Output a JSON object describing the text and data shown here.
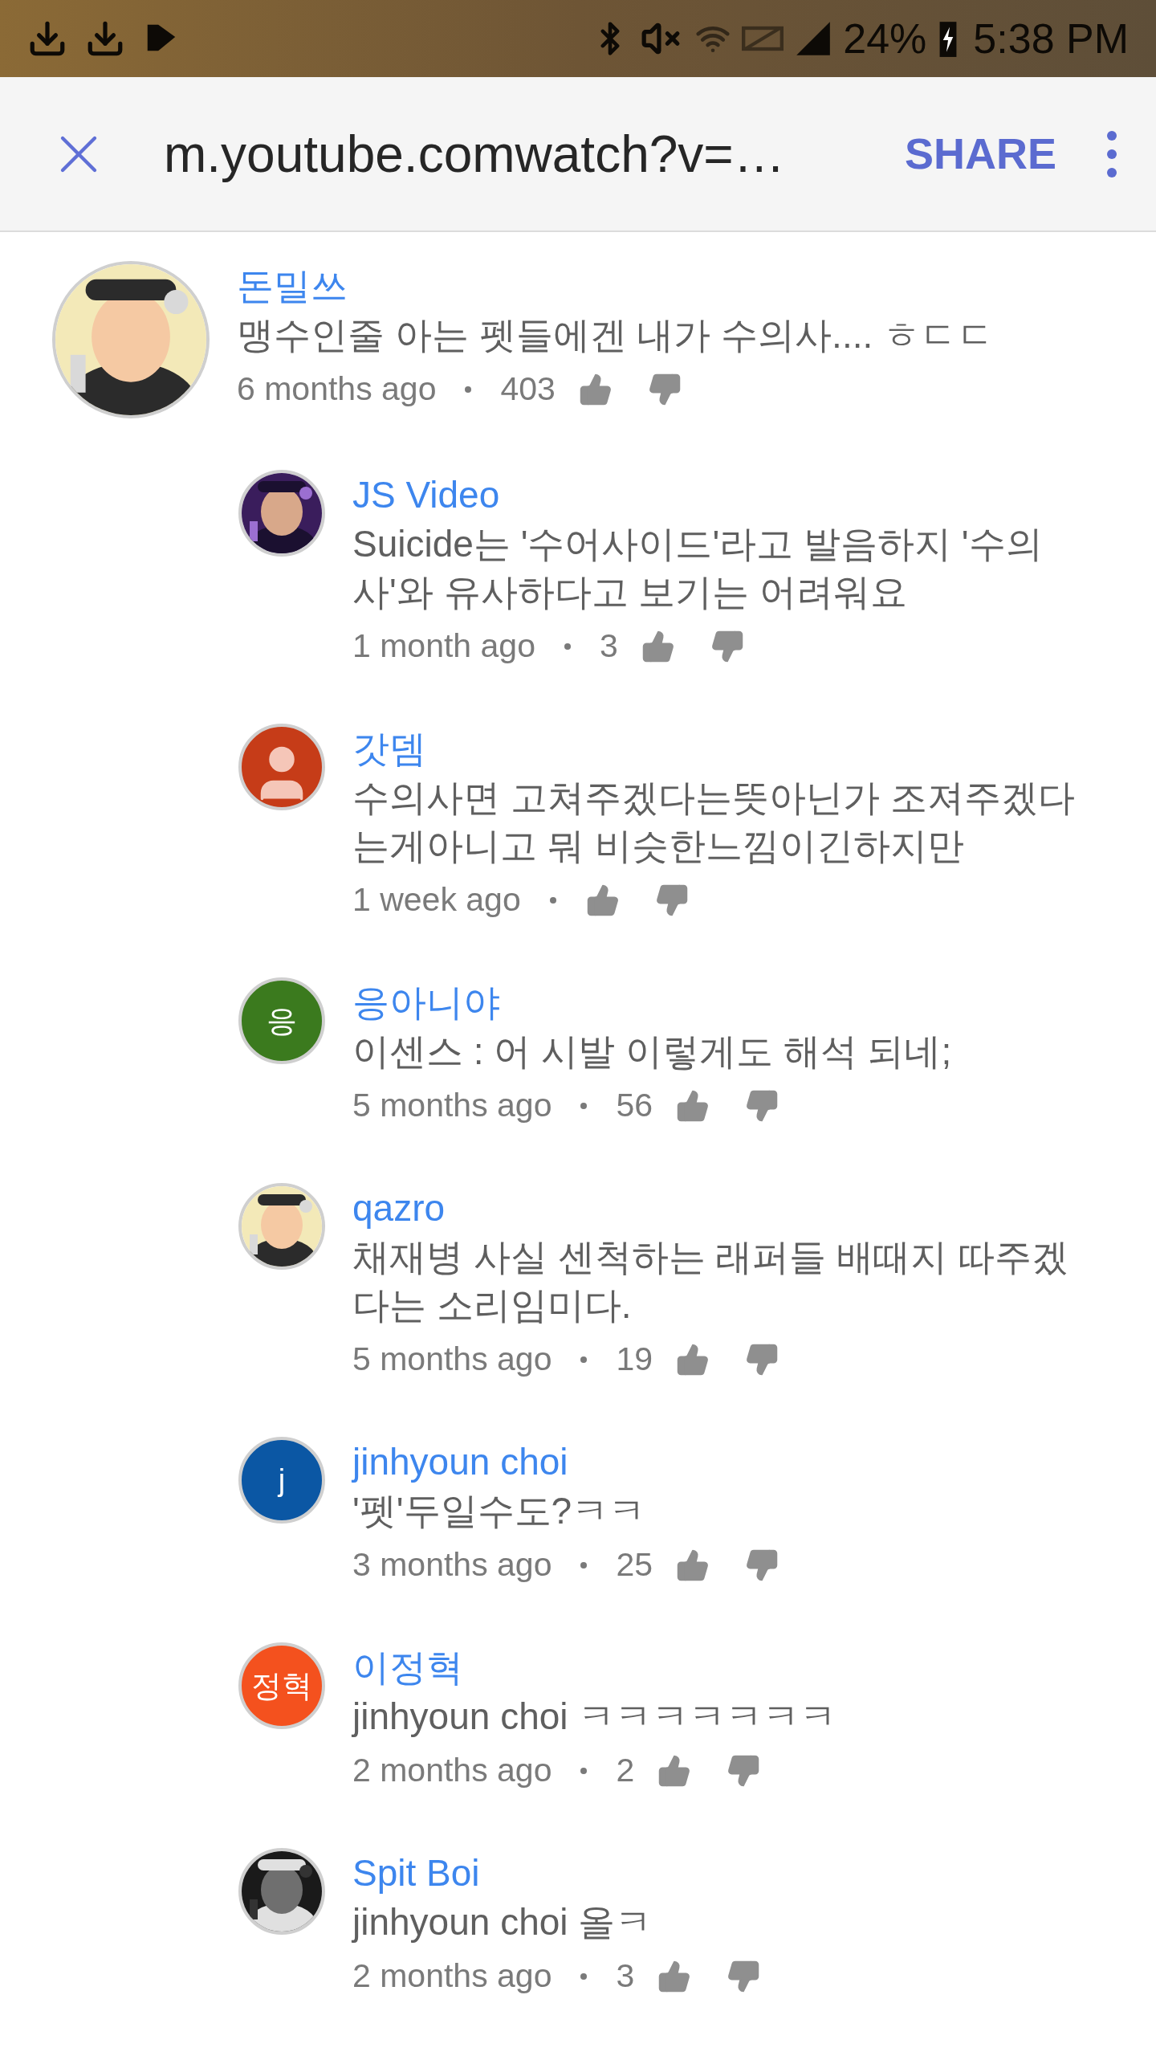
{
  "status_bar": {
    "battery": "24%",
    "time": "5:38 PM"
  },
  "toolbar": {
    "url": "m.youtube.comwatch?v=…",
    "share": "SHARE"
  },
  "comment": {
    "author": "돈밀쓰",
    "text": "맹수인줄 아는 펫들에겐 내가 수의사.... ㅎㄷㄷ",
    "time": "6 months ago",
    "likes": "403"
  },
  "replies": [
    {
      "author": "JS Video",
      "text": "Suicide는 '수어사이드'라고 발음하지 '수의사'와 유사하다고 보기는 어려워요",
      "time": "1 month ago",
      "likes": "3"
    },
    {
      "author": "갓뎀",
      "avatar": {
        "kind": "default",
        "color": "#c63c18"
      },
      "text": "수의사면 고쳐주겠다는뜻아닌가 조져주겠다는게아니고 뭐 비슷한느낌이긴하지만",
      "time": "1 week ago"
    },
    {
      "author": "응아니야",
      "avatar": {
        "kind": "letter",
        "text": "응",
        "color": "#3b7a1e"
      },
      "text": "이센스 : 어 시발 이렇게도 해석 되네;",
      "time": "5 months ago",
      "likes": "56"
    },
    {
      "author": "qazro",
      "text": "채재병 사실 센척하는 래퍼들 배때지 따주겠다는 소리임미다.",
      "time": "5 months ago",
      "likes": "19"
    },
    {
      "author": "jinhyoun choi",
      "avatar": {
        "kind": "letter",
        "text": "j",
        "color": "#0b57a4"
      },
      "text": "'펫'두일수도?ㅋㅋ",
      "time": "3 months ago",
      "likes": "25"
    },
    {
      "author": "이정혁",
      "avatar": {
        "kind": "letter",
        "text": "정혁",
        "color": "#f4511e"
      },
      "text": "jinhyoun choi ㅋㅋㅋㅋㅋㅋㅋ",
      "time": "2 months ago",
      "likes": "2"
    },
    {
      "author": "Spit Boi",
      "text": "jinhyoun choi 올ㅋ",
      "time": "2 months ago",
      "likes": "3"
    }
  ]
}
